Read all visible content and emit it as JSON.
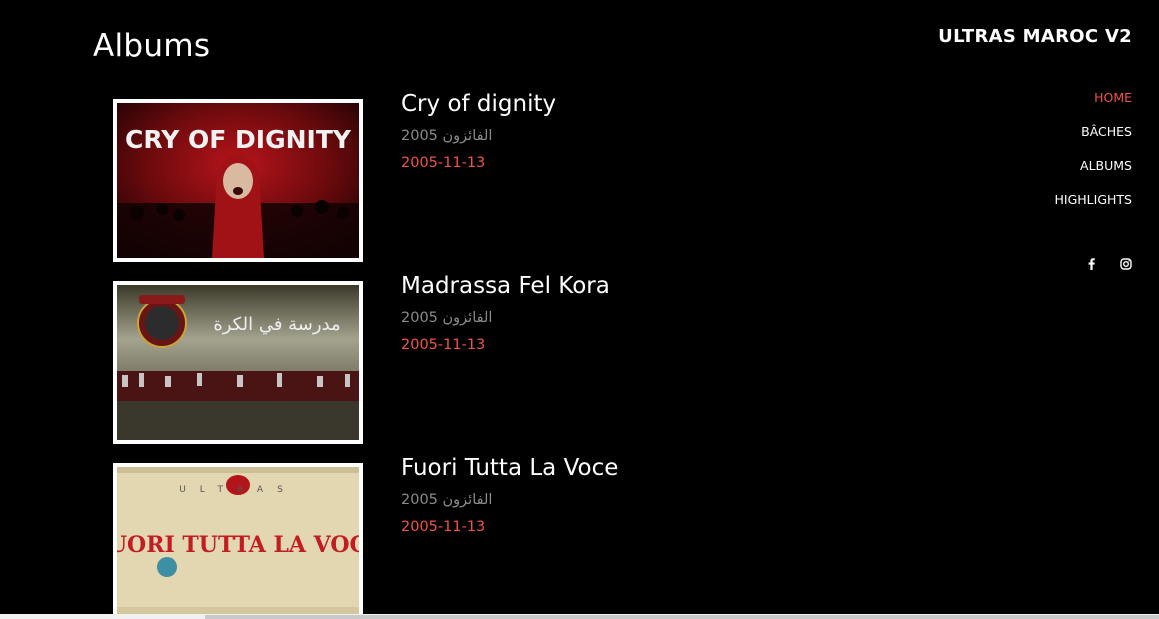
{
  "page": {
    "title": "Albums"
  },
  "brand": {
    "name": "ULTRAS MAROC V2"
  },
  "nav": {
    "items": [
      {
        "label": "HOME",
        "active": true
      },
      {
        "label": "BÂCHES",
        "active": false
      },
      {
        "label": "ALBUMS",
        "active": false
      },
      {
        "label": "HIGHLIGHTS",
        "active": false
      }
    ]
  },
  "social": {
    "icons": [
      "facebook-icon",
      "instagram-icon"
    ]
  },
  "albums": [
    {
      "title": "Cry of dignity",
      "artist": "الفائزون 2005",
      "date": "2005-11-13",
      "cover_text": "CRY OF DIGNITY"
    },
    {
      "title": "Madrassa Fel Kora",
      "artist": "الفائزون 2005",
      "date": "2005-11-13",
      "cover_text": "مدرسة في الكرة"
    },
    {
      "title": "Fuori Tutta La Voce",
      "artist": "الفائزون 2005",
      "date": "2005-11-13",
      "cover_text": "FUORI TUTTA LA VOCE"
    }
  ],
  "colors": {
    "accent": "#f0524a",
    "background": "#000000",
    "muted": "#8a8a8a"
  }
}
